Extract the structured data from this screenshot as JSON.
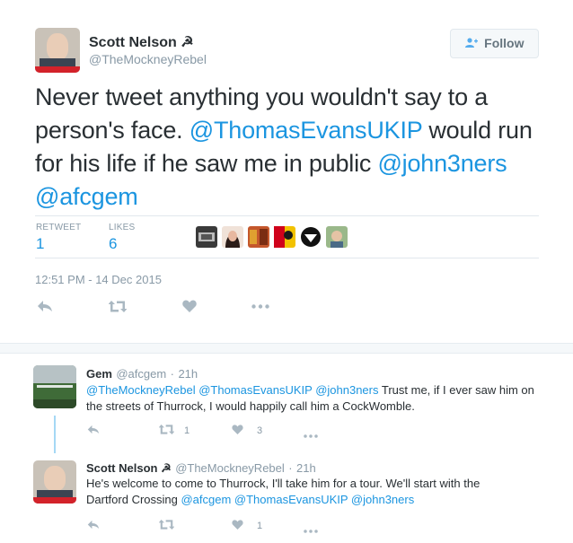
{
  "tweet": {
    "author_name": "Scott Nelson ☭",
    "author_handle": "@TheMockneyRebel",
    "avatar_banner": "Corbyn for PM",
    "follow_label": "Follow",
    "text_plain_1": "Never tweet anything you wouldn't say to a person's face. ",
    "mention_1": "@ThomasEvansUKIP",
    "text_plain_2": " would run for his life if he saw me in public ",
    "mention_2": "@john3ners",
    "mention_3": "@afcgem",
    "retweet_label": "RETWEET",
    "retweet_count": "1",
    "likes_label": "LIKES",
    "likes_count": "6",
    "timestamp": "12:51 PM - 14 Dec 2015",
    "actions": [
      "reply-icon",
      "retweet-icon",
      "heart-icon",
      "more-icon"
    ]
  },
  "replies": [
    {
      "name": "Gem",
      "handle": "@afcgem",
      "time": "21h",
      "mentions": "@TheMockneyRebel @ThomasEvansUKIP @john3ners",
      "text": " Trust me, if I ever saw him on the streets of Thurrock, I would happily call him a CockWomble.",
      "retweet_count": "1",
      "like_count": "3"
    },
    {
      "name": "Scott Nelson ☭",
      "handle": "@TheMockneyRebel",
      "time": "21h",
      "text_line_1": "He's welcome to come to Thurrock, I'll take him for a tour. We'll start with the",
      "text_line_2": "Dartford Crossing ",
      "mentions": "@afcgem @ThomasEvansUKIP @john3ners",
      "retweet_count": "",
      "like_count": "1"
    }
  ],
  "colors": {
    "link": "#1b95e0",
    "muted": "#8899a6",
    "icon": "#aab8c2",
    "text": "#292f33"
  }
}
